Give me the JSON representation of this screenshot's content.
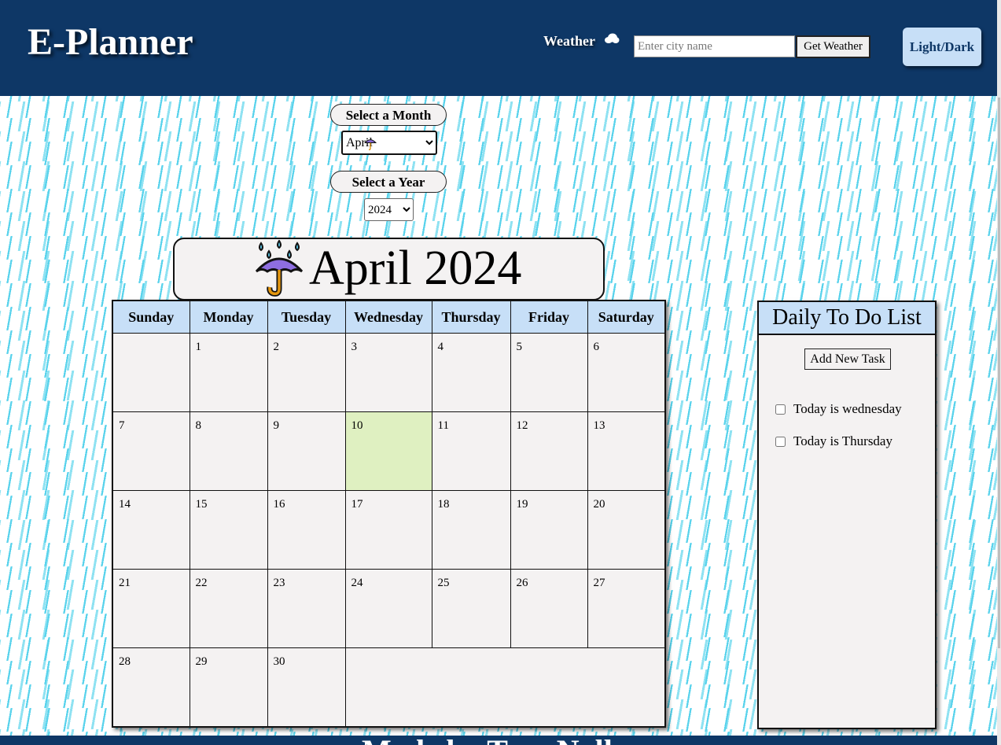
{
  "header": {
    "logo": "E-Planner",
    "weather_label": "Weather",
    "city_placeholder": "Enter city name",
    "get_weather_label": "Get Weather",
    "theme_toggle_label": "Light/Dark",
    "background_color": "#0e3766"
  },
  "controls": {
    "month_label": "Select a Month",
    "month_selected": "April",
    "month_icon": "umbrella-rain-icon",
    "year_label": "Select a Year",
    "year_selected": "2024"
  },
  "calendar": {
    "title": "April 2024",
    "title_icon": "umbrella-rain-icon",
    "weekdays": [
      "Sunday",
      "Monday",
      "Tuesday",
      "Wednesday",
      "Thursday",
      "Friday",
      "Saturday"
    ],
    "weeks": [
      [
        "",
        "1",
        "2",
        "3",
        "4",
        "5",
        "6"
      ],
      [
        "7",
        "8",
        "9",
        "10",
        "11",
        "12",
        "13"
      ],
      [
        "14",
        "15",
        "16",
        "17",
        "18",
        "19",
        "20"
      ],
      [
        "21",
        "22",
        "23",
        "24",
        "25",
        "26",
        "27"
      ],
      [
        "28",
        "29",
        "30"
      ]
    ],
    "highlighted_day": "10",
    "highlight_color": "#dff0c1"
  },
  "todo": {
    "title": "Daily To Do List",
    "add_label": "Add New Task",
    "tasks": [
      {
        "text": "Today is wednesday",
        "checked": false
      },
      {
        "text": "Today is Thursday",
        "checked": false
      }
    ]
  },
  "footer": {
    "text": "Made by Trey Nalley"
  }
}
